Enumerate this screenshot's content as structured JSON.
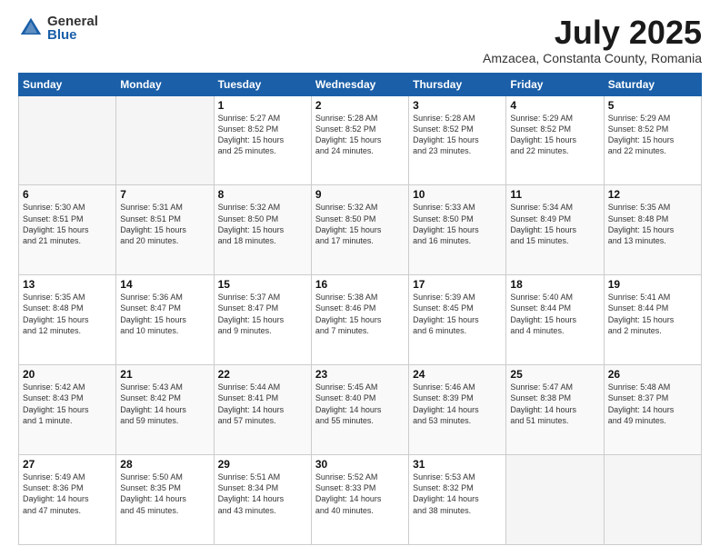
{
  "logo": {
    "general": "General",
    "blue": "Blue"
  },
  "title": "July 2025",
  "subtitle": "Amzacea, Constanta County, Romania",
  "headers": [
    "Sunday",
    "Monday",
    "Tuesday",
    "Wednesday",
    "Thursday",
    "Friday",
    "Saturday"
  ],
  "weeks": [
    [
      {
        "day": "",
        "info": ""
      },
      {
        "day": "",
        "info": ""
      },
      {
        "day": "1",
        "info": "Sunrise: 5:27 AM\nSunset: 8:52 PM\nDaylight: 15 hours\nand 25 minutes."
      },
      {
        "day": "2",
        "info": "Sunrise: 5:28 AM\nSunset: 8:52 PM\nDaylight: 15 hours\nand 24 minutes."
      },
      {
        "day": "3",
        "info": "Sunrise: 5:28 AM\nSunset: 8:52 PM\nDaylight: 15 hours\nand 23 minutes."
      },
      {
        "day": "4",
        "info": "Sunrise: 5:29 AM\nSunset: 8:52 PM\nDaylight: 15 hours\nand 22 minutes."
      },
      {
        "day": "5",
        "info": "Sunrise: 5:29 AM\nSunset: 8:52 PM\nDaylight: 15 hours\nand 22 minutes."
      }
    ],
    [
      {
        "day": "6",
        "info": "Sunrise: 5:30 AM\nSunset: 8:51 PM\nDaylight: 15 hours\nand 21 minutes."
      },
      {
        "day": "7",
        "info": "Sunrise: 5:31 AM\nSunset: 8:51 PM\nDaylight: 15 hours\nand 20 minutes."
      },
      {
        "day": "8",
        "info": "Sunrise: 5:32 AM\nSunset: 8:50 PM\nDaylight: 15 hours\nand 18 minutes."
      },
      {
        "day": "9",
        "info": "Sunrise: 5:32 AM\nSunset: 8:50 PM\nDaylight: 15 hours\nand 17 minutes."
      },
      {
        "day": "10",
        "info": "Sunrise: 5:33 AM\nSunset: 8:50 PM\nDaylight: 15 hours\nand 16 minutes."
      },
      {
        "day": "11",
        "info": "Sunrise: 5:34 AM\nSunset: 8:49 PM\nDaylight: 15 hours\nand 15 minutes."
      },
      {
        "day": "12",
        "info": "Sunrise: 5:35 AM\nSunset: 8:48 PM\nDaylight: 15 hours\nand 13 minutes."
      }
    ],
    [
      {
        "day": "13",
        "info": "Sunrise: 5:35 AM\nSunset: 8:48 PM\nDaylight: 15 hours\nand 12 minutes."
      },
      {
        "day": "14",
        "info": "Sunrise: 5:36 AM\nSunset: 8:47 PM\nDaylight: 15 hours\nand 10 minutes."
      },
      {
        "day": "15",
        "info": "Sunrise: 5:37 AM\nSunset: 8:47 PM\nDaylight: 15 hours\nand 9 minutes."
      },
      {
        "day": "16",
        "info": "Sunrise: 5:38 AM\nSunset: 8:46 PM\nDaylight: 15 hours\nand 7 minutes."
      },
      {
        "day": "17",
        "info": "Sunrise: 5:39 AM\nSunset: 8:45 PM\nDaylight: 15 hours\nand 6 minutes."
      },
      {
        "day": "18",
        "info": "Sunrise: 5:40 AM\nSunset: 8:44 PM\nDaylight: 15 hours\nand 4 minutes."
      },
      {
        "day": "19",
        "info": "Sunrise: 5:41 AM\nSunset: 8:44 PM\nDaylight: 15 hours\nand 2 minutes."
      }
    ],
    [
      {
        "day": "20",
        "info": "Sunrise: 5:42 AM\nSunset: 8:43 PM\nDaylight: 15 hours\nand 1 minute."
      },
      {
        "day": "21",
        "info": "Sunrise: 5:43 AM\nSunset: 8:42 PM\nDaylight: 14 hours\nand 59 minutes."
      },
      {
        "day": "22",
        "info": "Sunrise: 5:44 AM\nSunset: 8:41 PM\nDaylight: 14 hours\nand 57 minutes."
      },
      {
        "day": "23",
        "info": "Sunrise: 5:45 AM\nSunset: 8:40 PM\nDaylight: 14 hours\nand 55 minutes."
      },
      {
        "day": "24",
        "info": "Sunrise: 5:46 AM\nSunset: 8:39 PM\nDaylight: 14 hours\nand 53 minutes."
      },
      {
        "day": "25",
        "info": "Sunrise: 5:47 AM\nSunset: 8:38 PM\nDaylight: 14 hours\nand 51 minutes."
      },
      {
        "day": "26",
        "info": "Sunrise: 5:48 AM\nSunset: 8:37 PM\nDaylight: 14 hours\nand 49 minutes."
      }
    ],
    [
      {
        "day": "27",
        "info": "Sunrise: 5:49 AM\nSunset: 8:36 PM\nDaylight: 14 hours\nand 47 minutes."
      },
      {
        "day": "28",
        "info": "Sunrise: 5:50 AM\nSunset: 8:35 PM\nDaylight: 14 hours\nand 45 minutes."
      },
      {
        "day": "29",
        "info": "Sunrise: 5:51 AM\nSunset: 8:34 PM\nDaylight: 14 hours\nand 43 minutes."
      },
      {
        "day": "30",
        "info": "Sunrise: 5:52 AM\nSunset: 8:33 PM\nDaylight: 14 hours\nand 40 minutes."
      },
      {
        "day": "31",
        "info": "Sunrise: 5:53 AM\nSunset: 8:32 PM\nDaylight: 14 hours\nand 38 minutes."
      },
      {
        "day": "",
        "info": ""
      },
      {
        "day": "",
        "info": ""
      }
    ]
  ]
}
